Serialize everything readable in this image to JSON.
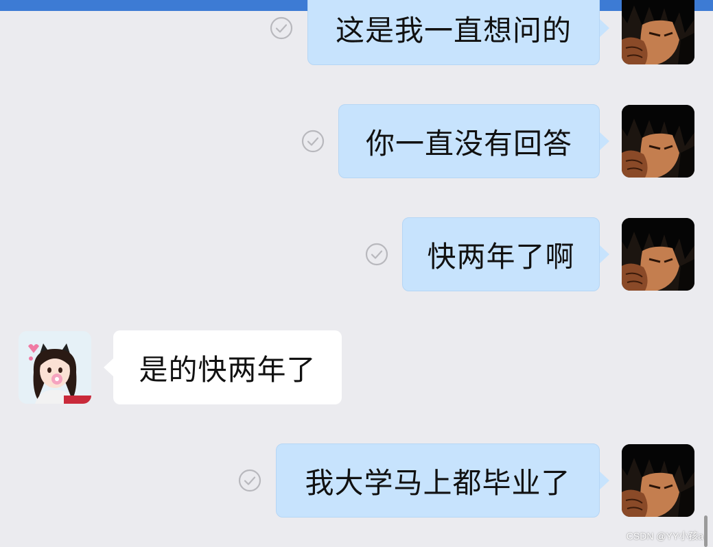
{
  "messages": [
    {
      "side": "out",
      "text": "这是我一直想问的",
      "read_icon": "check-circle-icon",
      "avatar": "male-anime-avatar-icon"
    },
    {
      "side": "out",
      "text": "你一直没有回答",
      "read_icon": "check-circle-icon",
      "avatar": "male-anime-avatar-icon"
    },
    {
      "side": "out",
      "text": "快两年了啊",
      "read_icon": "check-circle-icon",
      "avatar": "male-anime-avatar-icon"
    },
    {
      "side": "in",
      "text": "是的快两年了",
      "avatar": "female-cartoon-avatar-icon"
    },
    {
      "side": "out",
      "text": "我大学马上都毕业了",
      "read_icon": "check-circle-icon",
      "avatar": "male-anime-avatar-icon"
    }
  ],
  "watermark": "CSDN @YY小孩a",
  "colors": {
    "outgoing_bubble": "#c7e3fd",
    "incoming_bubble": "#ffffff",
    "background": "#ebebef",
    "top_bar": "#3d7bd4"
  }
}
